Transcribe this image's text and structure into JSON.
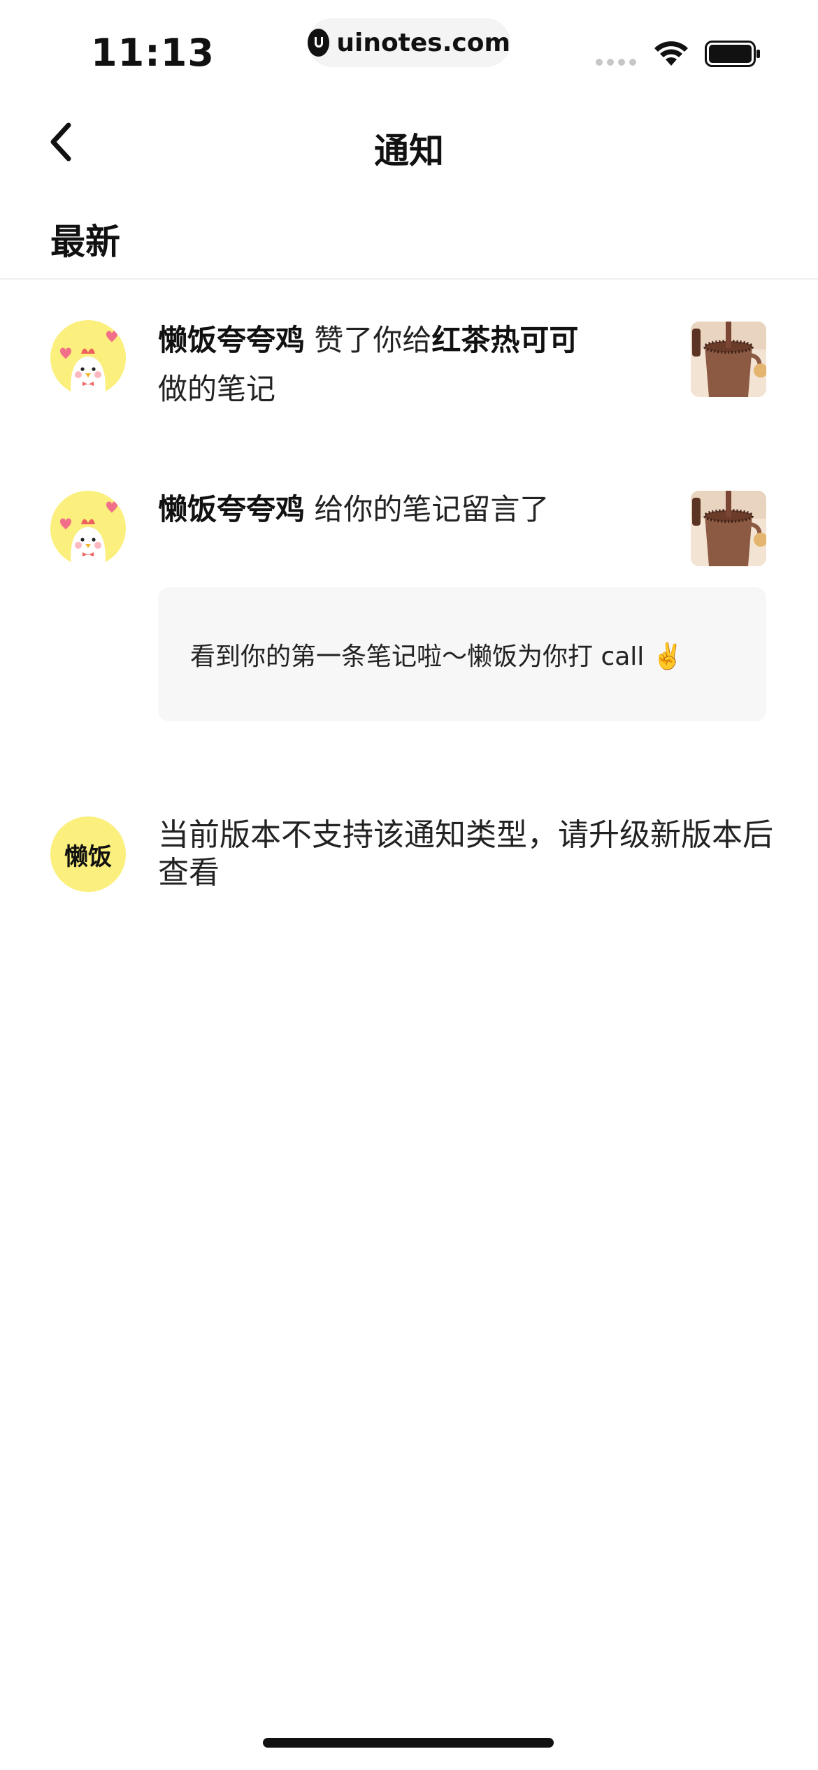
{
  "status_bar": {
    "time": "11:13",
    "url": "uinotes.com"
  },
  "nav": {
    "title": "通知",
    "back_icon": "chevron-left-icon"
  },
  "section": {
    "title": "最新"
  },
  "notifications": [
    {
      "user": "懒饭夸夸鸡",
      "action": "赞了你给",
      "target": "红茶热可可",
      "suffix": "做的笔记",
      "avatar": "chicken-avatar",
      "thumbnail": "hot-cocoa-thumbnail"
    },
    {
      "user": "懒饭夸夸鸡",
      "action": "给你的笔记留言了",
      "comment": "看到你的第一条笔记啦～懒饭为你打 call ✌️",
      "avatar": "chicken-avatar",
      "thumbnail": "hot-cocoa-thumbnail"
    },
    {
      "avatar_text": "懒饭",
      "message": "当前版本不支持该通知类型，请升级新版本后查看"
    }
  ],
  "colors": {
    "avatar_yellow": "#FBEF7D",
    "background": "#FFFFFF",
    "reply_bg": "#F7F7F7",
    "text": "#111111"
  }
}
